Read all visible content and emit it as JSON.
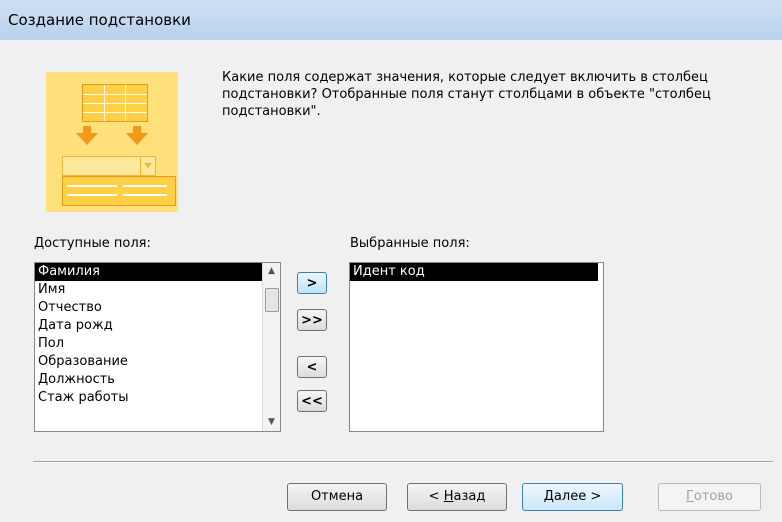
{
  "window": {
    "title": "Создание подстановки"
  },
  "question": "Какие поля содержат значения, которые следует включить в столбец подстановки? Отобранные поля станут столбцами в объекте \"столбец подстановки\".",
  "available": {
    "label": "Доступные поля:",
    "items": [
      "Фамилия",
      "Имя",
      "Отчество",
      "Дата рожд",
      "Пол",
      "Образование",
      "Должность",
      "Стаж работы"
    ],
    "selected_index": 0
  },
  "selected": {
    "label": "Выбранные поля:",
    "items": [
      "Идент код"
    ],
    "selected_index": 0
  },
  "move_buttons": {
    "add_one": ">",
    "add_all": ">>",
    "remove_one": "<",
    "remove_all": "<<"
  },
  "footer": {
    "cancel": "Отмена",
    "back_prefix": "< ",
    "back_accel": "Н",
    "back_rest": "азад",
    "next_accel": "Д",
    "next_rest": "алее >",
    "finish_accel": "Г",
    "finish_rest": "отово"
  },
  "icons": {
    "wizard": "lookup-wizard-illustration",
    "scroll_up": "scroll-up-arrow-icon",
    "scroll_down": "scroll-down-arrow-icon"
  },
  "colors": {
    "titlebar": "#b9d1ec",
    "illustration": "#ffe07a",
    "selection": "#000000"
  }
}
